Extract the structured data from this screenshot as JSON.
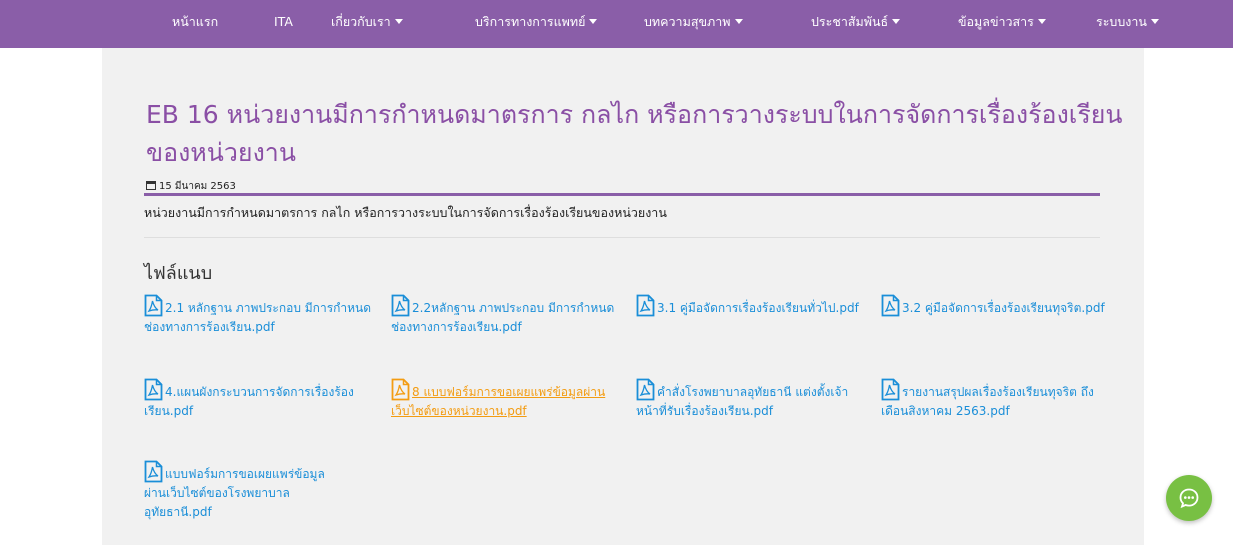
{
  "nav": {
    "items": [
      {
        "label": "หน้าแรก",
        "dropdown": false
      },
      {
        "label": "ITA",
        "dropdown": false
      },
      {
        "label": "เกี่ยวกับเรา",
        "dropdown": true
      },
      {
        "label": "บริการทางการแพทย์",
        "dropdown": true
      },
      {
        "label": "บทความสุขภาพ",
        "dropdown": true
      },
      {
        "label": "ประชาสัมพันธ์",
        "dropdown": true
      },
      {
        "label": "ข้อมูลข่าวสาร",
        "dropdown": true
      },
      {
        "label": "ระบบงาน",
        "dropdown": true
      }
    ]
  },
  "article": {
    "title": "EB 16 หน่วยงานมีการกำหนดมาตรการ กลไก หรือการวางระบบในการจัดการเรื่องร้องเรียนของหน่วยงาน",
    "date": "15 มีนาคม 2563",
    "description": "หน่วยงานมีการกำหนดมาตรการ กลไก หรือการวางระบบในการจัดการเรื่องร้องเรียนของหน่วยงาน"
  },
  "attachments": {
    "heading": "ไฟล์แนบ",
    "files": [
      {
        "name": "2.1 หลักฐาน ภาพประกอบ มีการกำหนดช่องทางการร้องเรียน.pdf",
        "active": false
      },
      {
        "name": "2.2หลักฐาน ภาพประกอบ มีการกำหนดช่องทางการร้องเรียน.pdf",
        "active": false
      },
      {
        "name": "3.1 คู่มือจัดการเรื่องร้องเรียนทั่วไป.pdf",
        "active": false
      },
      {
        "name": "3.2 คู่มือจัดการเรื่องร้องเรียนทุจริต.pdf",
        "active": false
      },
      {
        "name": "4.แผนผังกระบวนการจัดการเรื่องร้องเรียน.pdf",
        "active": false
      },
      {
        "name": "8 แบบฟอร์มการขอเผยแพร่ข้อมูลผ่านเว็บไซต์ของหน่วยงาน.pdf",
        "active": true
      },
      {
        "name": "คำสั่งโรงพยาบาลอุทัยธานี แต่งตั้งเจ้าหน้าที่รับเรื่องร้องเรียน.pdf",
        "active": false
      },
      {
        "name": "รายงานสรุปผลเรื่องร้องเรียนทุจริต ถึงเดือนสิงหาคม 2563.pdf",
        "active": false
      },
      {
        "name": "แบบฟอร์มการขอเผยแพร่ข้อมูลผ่านเว็บไซต์ของโรงพยาบาลอุทัยธานี.pdf",
        "active": false
      }
    ]
  },
  "colors": {
    "nav_bg": "#8a5ea8",
    "title": "#8a4fa5",
    "link": "#1a8ed8",
    "link_active": "#f39c12",
    "chat_button": "#78c043"
  },
  "icons": {
    "calendar": "calendar-icon",
    "file": "file-pdf-icon",
    "chat": "chat-icon"
  }
}
